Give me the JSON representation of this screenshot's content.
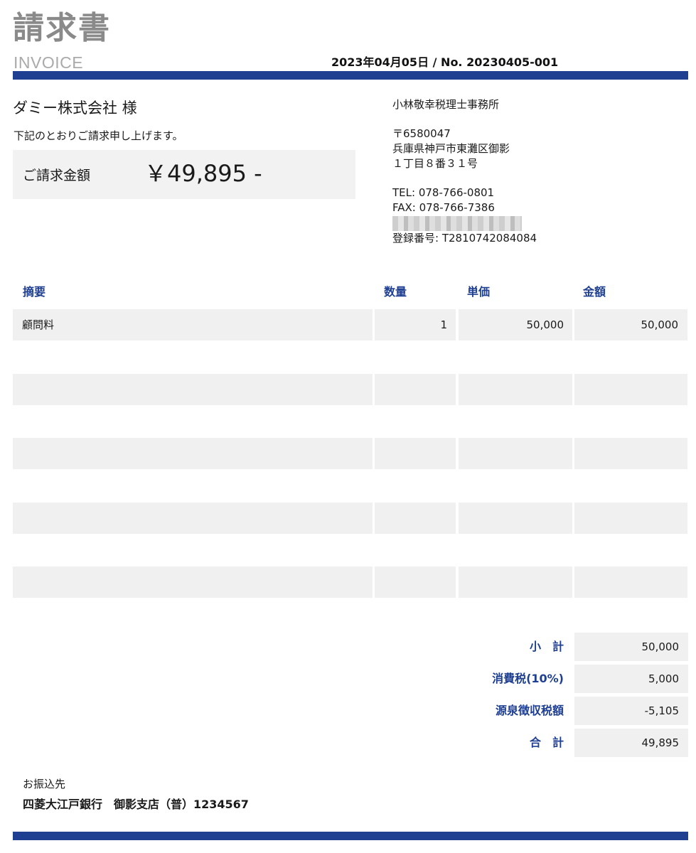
{
  "header": {
    "title_jp": "請求書",
    "title_en": "INVOICE",
    "date_no": "2023年04月05日 / No. 20230405-001"
  },
  "client": {
    "name": "ダミー株式会社 様",
    "message": "下記のとおりご請求申し上げます。",
    "amount_label": "ご請求金額",
    "amount_value": "￥49,895 -"
  },
  "issuer": {
    "name": "小林敬幸税理士事務所",
    "postal": "〒6580047",
    "address1": "兵庫県神戸市東灘区御影",
    "address2": "１丁目８番３１号",
    "tel": "TEL: 078-766-0801",
    "fax": "FAX: 078-766-7386",
    "registration": "登録番号: T2810742084084"
  },
  "table": {
    "headers": {
      "description": "摘要",
      "quantity": "数量",
      "unit_price": "単価",
      "amount": "金額"
    },
    "rows": [
      {
        "description": "顧問料",
        "quantity": "1",
        "unit_price": "50,000",
        "amount": "50,000"
      },
      {
        "description": "",
        "quantity": "",
        "unit_price": "",
        "amount": ""
      },
      {
        "description": "",
        "quantity": "",
        "unit_price": "",
        "amount": ""
      },
      {
        "description": "",
        "quantity": "",
        "unit_price": "",
        "amount": ""
      },
      {
        "description": "",
        "quantity": "",
        "unit_price": "",
        "amount": ""
      }
    ]
  },
  "summary": [
    {
      "label": "小　計",
      "value": "50,000"
    },
    {
      "label": "消費税(10%)",
      "value": "5,000"
    },
    {
      "label": "源泉徴収税額",
      "value": "-5,105"
    },
    {
      "label": "合　計",
      "value": "49,895"
    }
  ],
  "bank": {
    "label": "お振込先",
    "detail": "四菱大江戸銀行　御影支店（普）1234567"
  },
  "colors": {
    "accent": "#1f3f91",
    "cell_bg": "#f0f0f0",
    "title_gray": "#8a8a8a"
  }
}
